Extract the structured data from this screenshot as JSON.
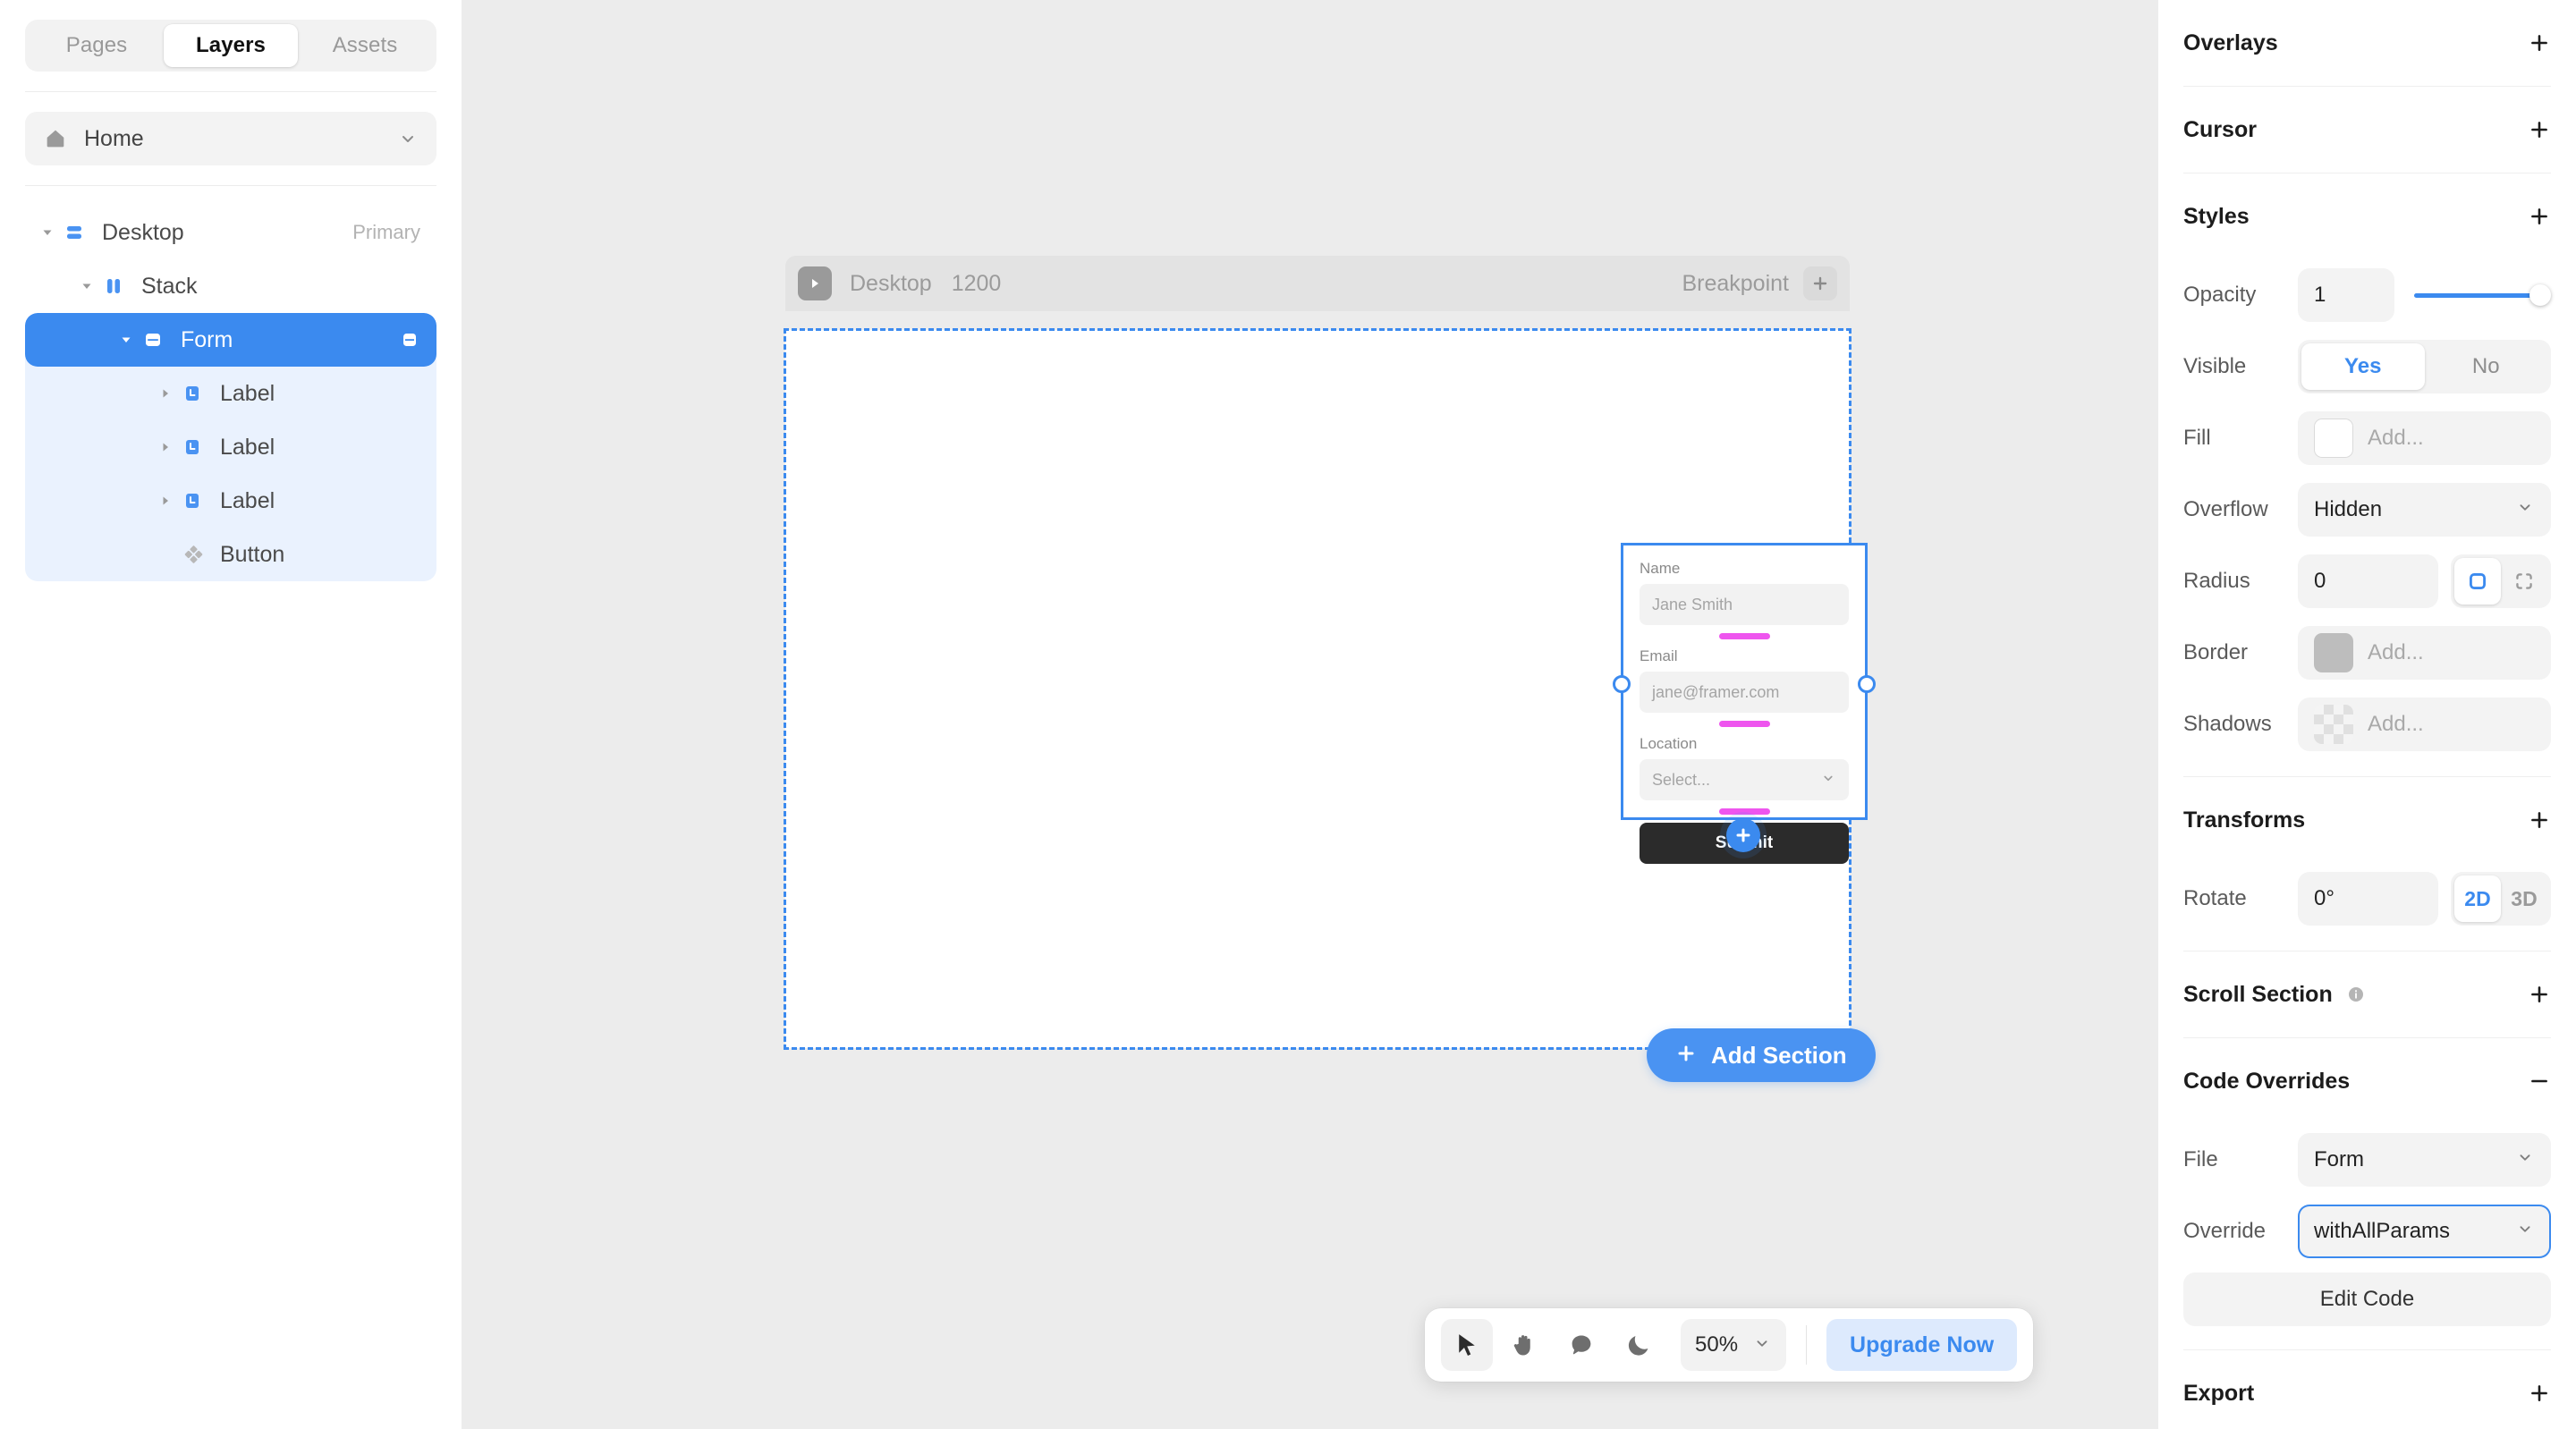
{
  "sidebar": {
    "tabs": [
      {
        "label": "Pages",
        "active": false
      },
      {
        "label": "Layers",
        "active": true
      },
      {
        "label": "Assets",
        "active": false
      }
    ],
    "page": {
      "label": "Home",
      "icon": "home-icon"
    },
    "layers": [
      {
        "name": "Desktop",
        "badge": "Primary",
        "icon": "stack-horizontal-icon",
        "depth": 0,
        "expanded": true,
        "selected": false
      },
      {
        "name": "Stack",
        "badge": "",
        "icon": "stack-vertical-icon",
        "depth": 1,
        "expanded": true,
        "selected": false
      },
      {
        "name": "Form",
        "badge": "",
        "icon": "component-icon",
        "depth": 2,
        "expanded": true,
        "selected": true
      },
      {
        "name": "Label",
        "badge": "",
        "icon": "label-icon",
        "depth": 3,
        "expanded": false,
        "selected": false
      },
      {
        "name": "Label",
        "badge": "",
        "icon": "label-icon",
        "depth": 3,
        "expanded": false,
        "selected": false
      },
      {
        "name": "Label",
        "badge": "",
        "icon": "label-icon",
        "depth": 3,
        "expanded": false,
        "selected": false
      },
      {
        "name": "Button",
        "badge": "",
        "icon": "component-instance-icon",
        "depth": 3,
        "expanded": false,
        "selected": false
      }
    ]
  },
  "canvas": {
    "breakpoint": {
      "name": "Desktop",
      "width": "1200",
      "action_label": "Breakpoint",
      "add_label": "+"
    },
    "form": {
      "fields": [
        {
          "label": "Name",
          "placeholder": "Jane Smith",
          "type": "text"
        },
        {
          "label": "Email",
          "placeholder": "jane@framer.com",
          "type": "text"
        },
        {
          "label": "Location",
          "placeholder": "Select...",
          "type": "select"
        }
      ],
      "submit_label": "Submit",
      "gap_marker_color": "#ee55ee",
      "selection_color": "#3b8aef"
    },
    "add_section_label": "Add Section"
  },
  "toolbar": {
    "tools": [
      {
        "name": "pointer-icon",
        "active": true
      },
      {
        "name": "hand-icon",
        "active": false
      },
      {
        "name": "comment-icon",
        "active": false
      },
      {
        "name": "moon-icon",
        "active": false
      }
    ],
    "zoom": "50%",
    "upgrade_label": "Upgrade Now"
  },
  "right_panel": {
    "sections": {
      "overlays": {
        "title": "Overlays",
        "toggle": "+"
      },
      "cursor": {
        "title": "Cursor",
        "toggle": "+"
      },
      "styles": {
        "title": "Styles",
        "toggle": "+"
      },
      "transforms": {
        "title": "Transforms",
        "toggle": "+"
      },
      "scroll_section": {
        "title": "Scroll Section",
        "toggle": "+"
      },
      "code_overrides": {
        "title": "Code Overrides",
        "toggle": "−"
      },
      "export": {
        "title": "Export",
        "toggle": "+"
      }
    },
    "styles": {
      "opacity": {
        "label": "Opacity",
        "value": "1",
        "slider_pct": 100
      },
      "visible": {
        "label": "Visible",
        "yes": "Yes",
        "no": "No",
        "selected": "Yes"
      },
      "fill": {
        "label": "Fill",
        "value": "Add...",
        "swatch": "#ffffff"
      },
      "overflow": {
        "label": "Overflow",
        "value": "Hidden"
      },
      "radius": {
        "label": "Radius",
        "value": "0",
        "mode": "uniform"
      },
      "border": {
        "label": "Border",
        "value": "Add...",
        "swatch": "#bdbdbd"
      },
      "shadows": {
        "label": "Shadows",
        "value": "Add...",
        "swatch": "checker"
      }
    },
    "transforms": {
      "rotate": {
        "label": "Rotate",
        "value": "0°",
        "dimension": "2D",
        "opt_2d": "2D",
        "opt_3d": "3D"
      }
    },
    "code_overrides": {
      "file": {
        "label": "File",
        "value": "Form"
      },
      "override": {
        "label": "Override",
        "value": "withAllParams"
      },
      "edit_code_label": "Edit Code"
    }
  },
  "colors": {
    "accent": "#3b8aef",
    "canvas_bg": "#ececec",
    "panel_bg": "#ffffff",
    "magenta": "#ee55ee"
  }
}
